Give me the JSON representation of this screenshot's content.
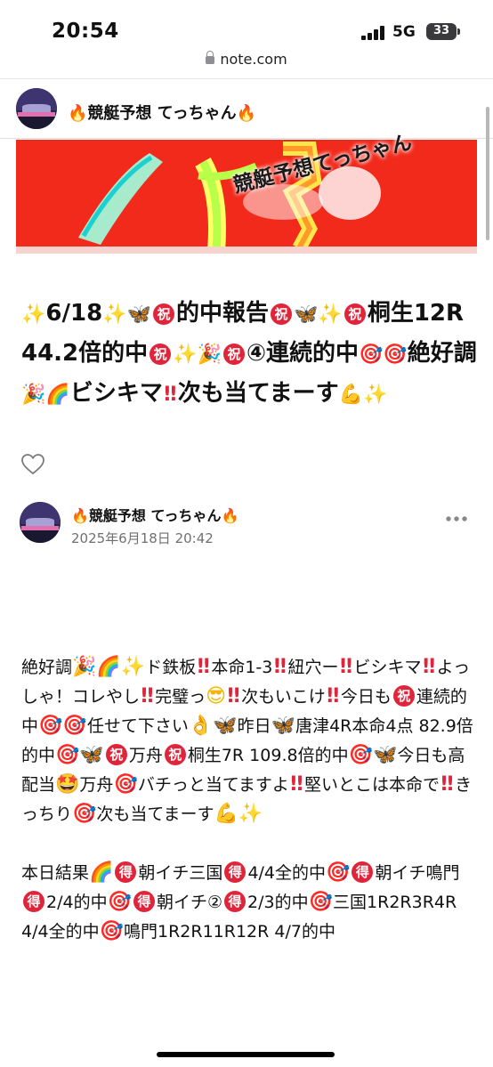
{
  "status_bar": {
    "time": "20:54",
    "network": "5G",
    "battery": "33"
  },
  "address_bar": {
    "url": "note.com"
  },
  "creator": {
    "name": "🔥競艇予想 てっちゃん🔥"
  },
  "banner": {
    "text": "競艇予想てっちゃん"
  },
  "article": {
    "title_segments": [
      {
        "t": "e",
        "cls": "e-spark",
        "v": "✨"
      },
      {
        "t": "s",
        "v": "6/18"
      },
      {
        "t": "e",
        "cls": "e-spark",
        "v": "✨"
      },
      {
        "t": "e",
        "cls": "e-butterfly",
        "v": "🦋"
      },
      {
        "t": "e",
        "cls": "e-iwai",
        "v": "祝"
      },
      {
        "t": "s",
        "v": "的中報告"
      },
      {
        "t": "e",
        "cls": "e-iwai",
        "v": "祝"
      },
      {
        "t": "e",
        "cls": "e-butterfly",
        "v": "🦋"
      },
      {
        "t": "e",
        "cls": "e-spark",
        "v": "✨"
      },
      {
        "t": "e",
        "cls": "e-iwai",
        "v": "祝"
      },
      {
        "t": "s",
        "v": "桐生12R 44.2倍的中"
      },
      {
        "t": "e",
        "cls": "e-iwai",
        "v": "祝"
      },
      {
        "t": "e",
        "cls": "e-spark",
        "v": "✨"
      },
      {
        "t": "e",
        "cls": "e-party",
        "v": "🎉"
      },
      {
        "t": "e",
        "cls": "e-iwai",
        "v": "祝"
      },
      {
        "t": "s",
        "v": "④連続的中"
      },
      {
        "t": "e",
        "cls": "e-dart",
        "v": "🎯"
      },
      {
        "t": "e",
        "cls": "e-dart",
        "v": "🎯"
      },
      {
        "t": "s",
        "v": "絶好調"
      },
      {
        "t": "e",
        "cls": "e-party",
        "v": "🎉"
      },
      {
        "t": "e",
        "cls": "e-rainbow",
        "v": "🌈"
      },
      {
        "t": "s",
        "v": "ビシキマ"
      },
      {
        "t": "e",
        "cls": "e-bang",
        "v": "!!"
      },
      {
        "t": "s",
        "v": "次も当てまーす"
      },
      {
        "t": "e",
        "cls": "e-muscle",
        "v": "💪"
      },
      {
        "t": "e",
        "cls": "e-spark",
        "v": "✨"
      }
    ],
    "author_name": "🔥競艇予想 てっちゃん🔥",
    "date": "2025年6月18日 20:42",
    "paragraphs": [
      [
        {
          "t": "s",
          "v": "絶好調"
        },
        {
          "t": "e",
          "cls": "e-party",
          "v": "🎉"
        },
        {
          "t": "e",
          "cls": "e-rainbow",
          "v": "🌈"
        },
        {
          "t": "e",
          "cls": "e-spark",
          "v": "✨"
        },
        {
          "t": "s",
          "v": "ド鉄板"
        },
        {
          "t": "e",
          "cls": "e-bang",
          "v": "!!"
        },
        {
          "t": "s",
          "v": "本命1-3"
        },
        {
          "t": "e",
          "cls": "e-bang",
          "v": "!!"
        },
        {
          "t": "s",
          "v": "紐穴ー"
        },
        {
          "t": "e",
          "cls": "e-bang",
          "v": "!!"
        },
        {
          "t": "s",
          "v": "ビシキマ"
        },
        {
          "t": "e",
          "cls": "e-bang",
          "v": "!!"
        },
        {
          "t": "s",
          "v": "よっしゃ！コレやし"
        },
        {
          "t": "e",
          "cls": "e-bang",
          "v": "!!"
        },
        {
          "t": "s",
          "v": "完璧っ"
        },
        {
          "t": "e",
          "cls": "e-cool",
          "v": "😎"
        },
        {
          "t": "e",
          "cls": "e-bang",
          "v": "!!"
        },
        {
          "t": "s",
          "v": "次もいこけ"
        },
        {
          "t": "e",
          "cls": "e-bang",
          "v": "!!"
        },
        {
          "t": "s",
          "v": "今日も"
        },
        {
          "t": "e",
          "cls": "e-iwai",
          "v": "祝"
        },
        {
          "t": "s",
          "v": "連続的中"
        },
        {
          "t": "e",
          "cls": "e-dart",
          "v": "🎯"
        },
        {
          "t": "e",
          "cls": "e-dart",
          "v": "🎯"
        },
        {
          "t": "s",
          "v": "任せて下さい"
        },
        {
          "t": "e",
          "cls": "e-ok",
          "v": "👌"
        },
        {
          "t": "e",
          "cls": "e-butterfly",
          "v": "🦋"
        },
        {
          "t": "s",
          "v": "昨日"
        },
        {
          "t": "e",
          "cls": "e-butterfly",
          "v": "🦋"
        },
        {
          "t": "s",
          "v": "唐津4R本命4点 82.9倍的中"
        },
        {
          "t": "e",
          "cls": "e-dart",
          "v": "🎯"
        },
        {
          "t": "e",
          "cls": "e-butterfly",
          "v": "🦋"
        },
        {
          "t": "e",
          "cls": "e-iwai",
          "v": "祝"
        },
        {
          "t": "s",
          "v": "万舟"
        },
        {
          "t": "e",
          "cls": "e-iwai",
          "v": "祝"
        },
        {
          "t": "s",
          "v": "桐生7R 109.8倍的中"
        },
        {
          "t": "e",
          "cls": "e-dart",
          "v": "🎯"
        },
        {
          "t": "e",
          "cls": "e-butterfly",
          "v": "🦋"
        },
        {
          "t": "s",
          "v": "今日も高配当"
        },
        {
          "t": "e",
          "cls": "e-star",
          "v": "🤩"
        },
        {
          "t": "s",
          "v": "万舟"
        },
        {
          "t": "e",
          "cls": "e-dart",
          "v": "🎯"
        },
        {
          "t": "s",
          "v": "バチっと当てますよ"
        },
        {
          "t": "e",
          "cls": "e-bang",
          "v": "!!"
        },
        {
          "t": "s",
          "v": "堅いとこは本命で"
        },
        {
          "t": "e",
          "cls": "e-bang",
          "v": "!!"
        },
        {
          "t": "s",
          "v": "きっちり"
        },
        {
          "t": "e",
          "cls": "e-dart",
          "v": "🎯"
        },
        {
          "t": "s",
          "v": "次も当てまーす"
        },
        {
          "t": "e",
          "cls": "e-muscle",
          "v": "💪"
        },
        {
          "t": "e",
          "cls": "e-spark",
          "v": "✨"
        }
      ],
      [
        {
          "t": "s",
          "v": "本日結果"
        },
        {
          "t": "e",
          "cls": "e-rainbow",
          "v": "🌈"
        },
        {
          "t": "e",
          "cls": "e-toku",
          "v": "得"
        },
        {
          "t": "s",
          "v": "朝イチ三国"
        },
        {
          "t": "e",
          "cls": "e-toku",
          "v": "得"
        },
        {
          "t": "s",
          "v": "4/4全的中"
        },
        {
          "t": "e",
          "cls": "e-dart",
          "v": "🎯"
        },
        {
          "t": "e",
          "cls": "e-toku",
          "v": "得"
        },
        {
          "t": "s",
          "v": "朝イチ鳴門"
        },
        {
          "t": "e",
          "cls": "e-toku",
          "v": "得"
        },
        {
          "t": "s",
          "v": "2/4的中"
        },
        {
          "t": "e",
          "cls": "e-dart",
          "v": "🎯"
        },
        {
          "t": "e",
          "cls": "e-toku",
          "v": "得"
        },
        {
          "t": "s",
          "v": "朝イチ②"
        },
        {
          "t": "e",
          "cls": "e-toku",
          "v": "得"
        },
        {
          "t": "s",
          "v": "2/3的中"
        },
        {
          "t": "e",
          "cls": "e-dart",
          "v": "🎯"
        },
        {
          "t": "s",
          "v": "三国1R2R3R4R 4/4全的中"
        },
        {
          "t": "e",
          "cls": "e-dart",
          "v": "🎯"
        },
        {
          "t": "s",
          "v": "鳴門1R2R11R12R 4/7的中"
        }
      ]
    ]
  }
}
